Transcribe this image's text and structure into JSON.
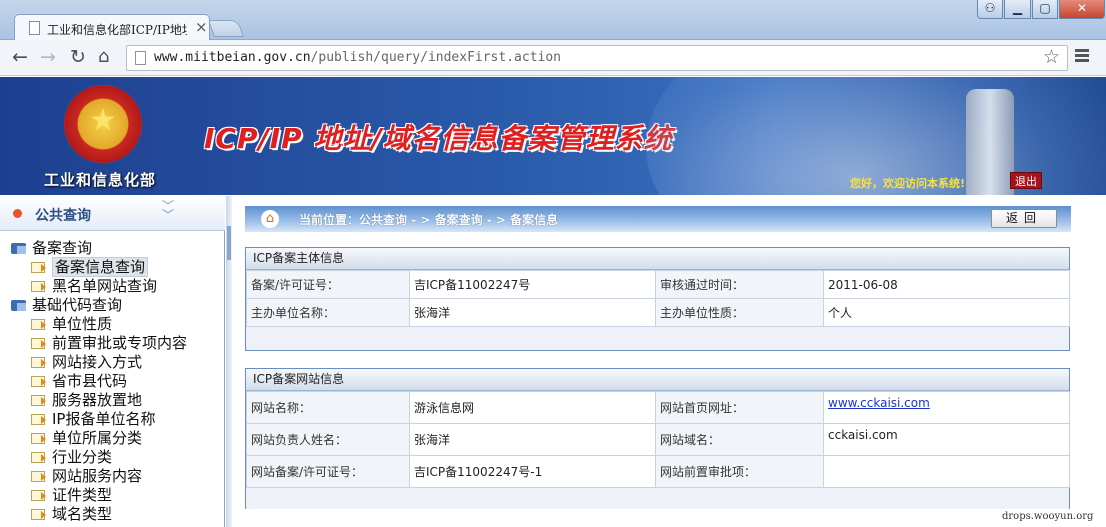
{
  "browser": {
    "tab_title": "工业和信息化部ICP/IP地址",
    "url_host": "www.miitbeian.gov.cn",
    "url_path": "/publish/query/indexFirst.action"
  },
  "banner": {
    "ministry_name": "工业和信息化部",
    "system_title": "ICP/IP 地址/域名信息备案管理系统",
    "welcome": "您好，欢迎访问本系统!",
    "logout": "退出"
  },
  "sidebar": {
    "header": "公共查询",
    "tree": [
      {
        "type": "group",
        "label": "备案查询"
      },
      {
        "type": "leaf",
        "label": "备案信息查询",
        "selected": true
      },
      {
        "type": "leaf",
        "label": "黑名单网站查询"
      },
      {
        "type": "group",
        "label": "基础代码查询"
      },
      {
        "type": "leaf",
        "label": "单位性质"
      },
      {
        "type": "leaf",
        "label": "前置审批或专项内容"
      },
      {
        "type": "leaf",
        "label": "网站接入方式"
      },
      {
        "type": "leaf",
        "label": "省市县代码"
      },
      {
        "type": "leaf",
        "label": "服务器放置地"
      },
      {
        "type": "leaf",
        "label": "IP报备单位名称"
      },
      {
        "type": "leaf",
        "label": "单位所属分类"
      },
      {
        "type": "leaf",
        "label": "行业分类"
      },
      {
        "type": "leaf",
        "label": "网站服务内容"
      },
      {
        "type": "leaf",
        "label": "证件类型"
      },
      {
        "type": "leaf",
        "label": "域名类型"
      }
    ]
  },
  "main": {
    "breadcrumb": "当前位置：公共查询 - > 备案查询 - > 备案信息",
    "back_button": "返回",
    "subject_panel": {
      "title": "ICP备案主体信息",
      "license_label": "备案/许可证号：",
      "license_value": "吉ICP备11002247号",
      "approved_label": "审核通过时间：",
      "approved_value": "2011-06-08",
      "org_label": "主办单位名称：",
      "org_value": "张海洋",
      "nature_label": "主办单位性质：",
      "nature_value": "个人"
    },
    "site_panel": {
      "title": "ICP备案网站信息",
      "site_name_label": "网站名称：",
      "site_name_value": "游泳信息网",
      "homepage_label": "网站首页网址：",
      "homepage_value": "www.cckaisi.com",
      "owner_label": "网站负责人姓名：",
      "owner_value": "张海洋",
      "domain_label": "网站域名：",
      "domain_value": "cckaisi.com",
      "site_license_label": "网站备案/许可证号：",
      "site_license_value": "吉ICP备11002247号-1",
      "preapproval_label": "网站前置审批项：",
      "preapproval_value": ""
    }
  },
  "watermark": "drops.wooyun.org"
}
